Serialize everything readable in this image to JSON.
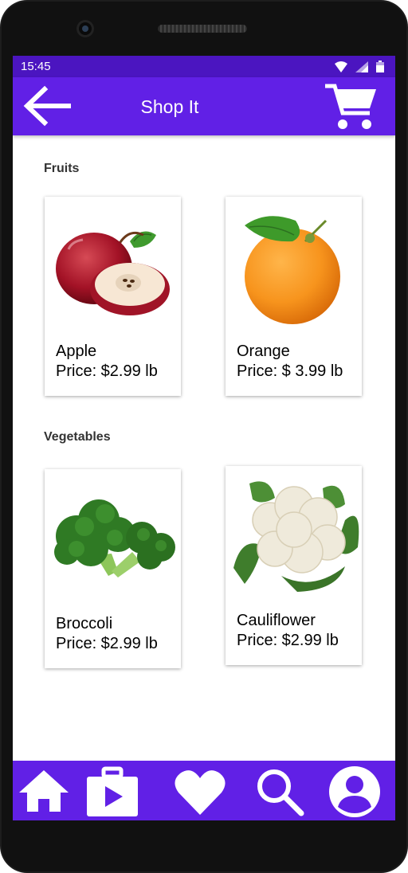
{
  "status_bar": {
    "time": "15:45",
    "icons": [
      "wifi-icon",
      "signal-icon",
      "battery-icon"
    ]
  },
  "app_bar": {
    "title": "Shop It",
    "back_icon": "arrow-left-icon",
    "cart_icon": "shopping-cart-icon"
  },
  "sections": [
    {
      "title": "Fruits",
      "products": [
        {
          "name": "Apple",
          "price": "Price: $2.99 lb",
          "image": "apple-image"
        },
        {
          "name": "Orange",
          "price": "Price: $ 3.99 lb",
          "image": "orange-image"
        }
      ]
    },
    {
      "title": "Vegetables",
      "products": [
        {
          "name": "Broccoli",
          "price": "Price: $2.99 lb",
          "image": "broccoli-image"
        },
        {
          "name": "Cauliflower",
          "price": "Price: $2.99 lb",
          "image": "cauliflower-image"
        }
      ]
    }
  ],
  "bottom_nav": [
    "home-icon",
    "video-bag-icon",
    "heart-icon",
    "search-icon",
    "account-icon"
  ],
  "colors": {
    "status_bar": "#4b15c0",
    "app_bar": "#6120e6",
    "bottom_nav": "#6120e6",
    "section_title": "#333333"
  }
}
